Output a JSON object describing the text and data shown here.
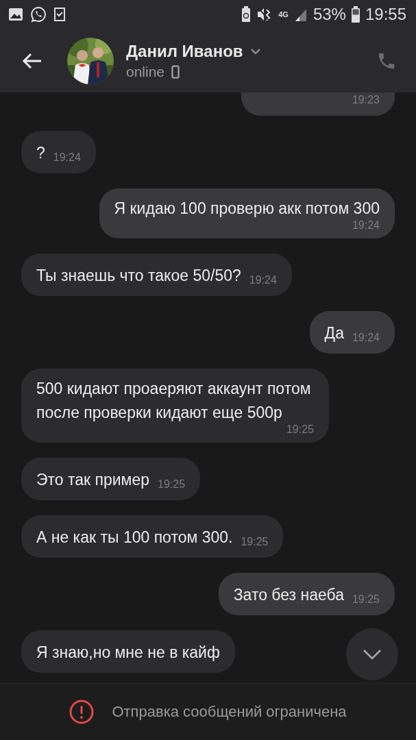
{
  "status_bar": {
    "network": "4G",
    "battery": "53%",
    "time": "19:55"
  },
  "header": {
    "name": "Данил Иванов",
    "status": "online"
  },
  "messages": [
    {
      "kind": "outgoing",
      "time": "19:23"
    },
    {
      "kind": "incoming",
      "text": "?",
      "time": "19:24"
    },
    {
      "kind": "outgoing",
      "text": "Я кидаю 100 проверю акк потом 300",
      "time": "19:24"
    },
    {
      "kind": "incoming",
      "text": "Ты знаешь что такое 50/50?",
      "time": "19:24"
    },
    {
      "kind": "outgoing",
      "text": "Да",
      "time": "19:24"
    },
    {
      "kind": "incoming",
      "text": "500 кидают проаеряют аккаунт потом после проверки кидают еще 500р",
      "time": "19:25"
    },
    {
      "kind": "incoming",
      "text": "Это так пример",
      "time": "19:25"
    },
    {
      "kind": "incoming",
      "text": "А не как ты 100 потом 300.",
      "time": "19:25"
    },
    {
      "kind": "outgoing",
      "text": "Зато без наеба",
      "time": "19:25"
    },
    {
      "kind": "incoming",
      "text": "Я знаю,но мне не в кайф"
    }
  ],
  "footer": {
    "notice": "Отправка сообщений ограничена"
  }
}
